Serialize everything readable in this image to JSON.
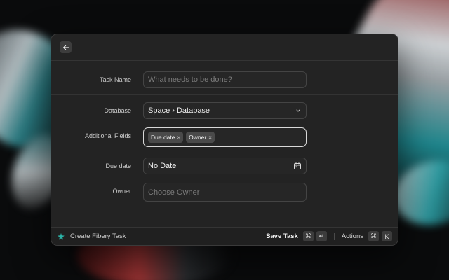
{
  "form": {
    "task_name": {
      "label": "Task Name",
      "placeholder": "What needs to be done?"
    },
    "database": {
      "label": "Database",
      "value": "Space › Database"
    },
    "additional_fields": {
      "label": "Additional Fields",
      "tags": [
        "Due date",
        "Owner"
      ]
    },
    "due_date": {
      "label": "Due date",
      "value": "No Date"
    },
    "owner": {
      "label": "Owner",
      "placeholder": "Choose Owner"
    }
  },
  "footer": {
    "title": "Create Fibery Task",
    "save_label": "Save Task",
    "save_keys": [
      "⌘",
      "↵"
    ],
    "actions_label": "Actions",
    "actions_keys": [
      "⌘",
      "K"
    ]
  },
  "icons": {
    "back": "arrow-left-icon",
    "chevron": "chevron-down-icon",
    "calendar": "calendar-icon",
    "logo": "fibery-logo-icon",
    "tag_remove": "close-icon"
  },
  "colors": {
    "accent": "#2bb3a7",
    "focus_border": "#d8d8d8"
  }
}
